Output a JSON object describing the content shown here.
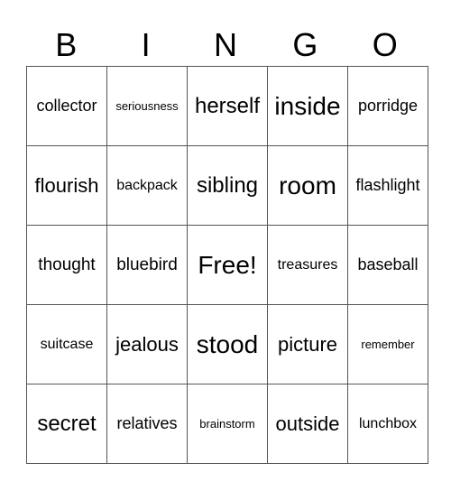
{
  "header": [
    "B",
    "I",
    "N",
    "G",
    "O"
  ],
  "cells": [
    [
      "collector",
      "seriousness",
      "herself",
      "inside",
      "porridge"
    ],
    [
      "flourish",
      "backpack",
      "sibling",
      "room",
      "flashlight"
    ],
    [
      "thought",
      "bluebird",
      "Free!",
      "treasures",
      "baseball"
    ],
    [
      "suitcase",
      "jealous",
      "stood",
      "picture",
      "remember"
    ],
    [
      "secret",
      "relatives",
      "brainstorm",
      "outside",
      "lunchbox"
    ]
  ]
}
